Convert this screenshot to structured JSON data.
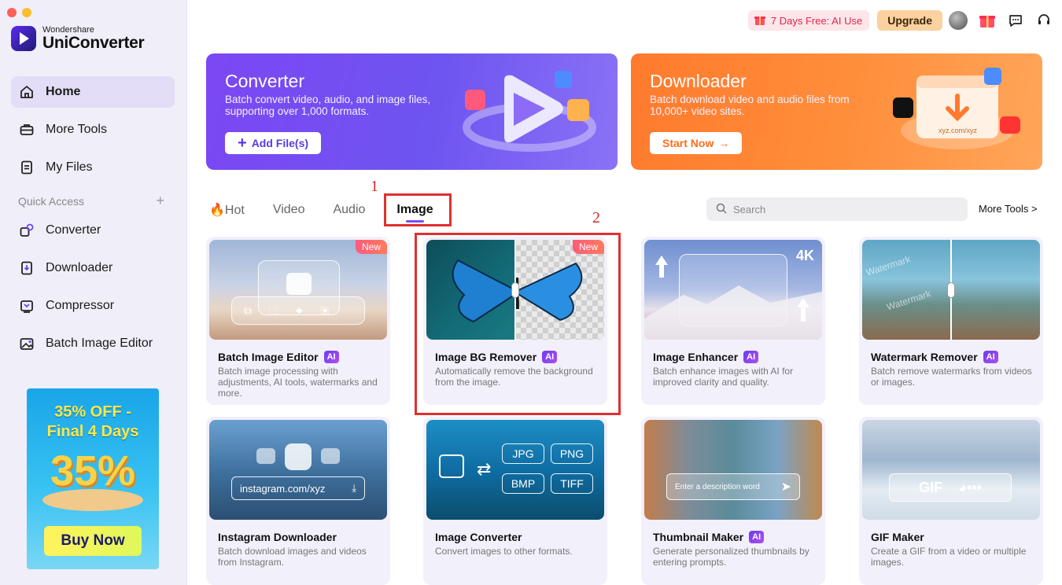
{
  "app": {
    "brand_top": "Wondershare",
    "brand_name": "UniConverter"
  },
  "sidebar": {
    "nav": [
      {
        "label": "Home",
        "icon": "home-icon",
        "active": true
      },
      {
        "label": "More Tools",
        "icon": "toolbox-icon"
      },
      {
        "label": "My Files",
        "icon": "files-icon"
      }
    ],
    "quick_access_title": "Quick Access",
    "quick_access": [
      {
        "label": "Converter",
        "icon": "converter-icon"
      },
      {
        "label": "Downloader",
        "icon": "downloader-icon"
      },
      {
        "label": "Compressor",
        "icon": "compressor-icon"
      },
      {
        "label": "Batch Image Editor",
        "icon": "batch-image-icon"
      }
    ],
    "promo": {
      "title_line1": "35% OFF -",
      "title_line2": "Final 4 Days",
      "big": "35%",
      "button": "Buy Now"
    }
  },
  "topbar": {
    "trial": "7 Days Free: AI Use",
    "upgrade": "Upgrade"
  },
  "banners": {
    "converter": {
      "title": "Converter",
      "desc": "Batch convert video, audio, and image files, supporting over 1,000 formats.",
      "button": "Add File(s)"
    },
    "downloader": {
      "title": "Downloader",
      "desc": "Batch download video and audio files from 10,000+ video sites.",
      "button": "Start Now",
      "url_text": "xyz.com/xyz"
    }
  },
  "tabs": [
    {
      "label": "Hot",
      "active": false
    },
    {
      "label": "Video",
      "active": false
    },
    {
      "label": "Audio",
      "active": false
    },
    {
      "label": "Image",
      "active": true
    }
  ],
  "annotations": {
    "first": "1",
    "second": "2"
  },
  "search": {
    "placeholder": "Search"
  },
  "more_tools": "More Tools >",
  "cards": [
    {
      "title": "Batch Image Editor",
      "ai": "AI",
      "new": "New",
      "desc": "Batch image processing with adjustments, AI tools, watermarks and more."
    },
    {
      "title": "Image BG Remover",
      "ai": "AI",
      "new": "New",
      "desc": "Automatically remove the background from the image."
    },
    {
      "title": "Image Enhancer",
      "ai": "AI",
      "badge": "4K",
      "desc": "Batch enhance images with AI for improved clarity and quality."
    },
    {
      "title": "Watermark Remover",
      "ai": "AI",
      "watermark_text": "Watermark",
      "desc": "Batch remove watermarks from videos or images."
    },
    {
      "title": "Instagram Downloader",
      "url": "instagram.com/xyz",
      "desc": "Batch download images and videos from Instagram."
    },
    {
      "title": "Image Converter",
      "formats": [
        "JPG",
        "PNG",
        "BMP",
        "TIFF"
      ],
      "desc": "Convert images to other formats."
    },
    {
      "title": "Thumbnail Maker",
      "ai": "AI",
      "prompt": "Enter a description word",
      "desc": "Generate personalized thumbnails by entering prompts."
    },
    {
      "title": "GIF Maker",
      "gif_label": "GIF",
      "desc": "Create a GIF from a video or multiple images."
    }
  ]
}
